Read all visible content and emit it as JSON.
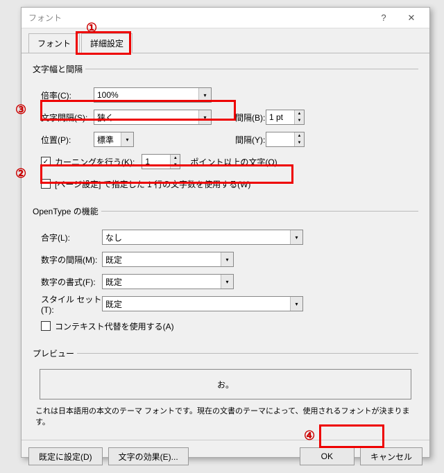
{
  "dialog": {
    "title": "フォント",
    "help": "?",
    "close": "✕"
  },
  "tabs": {
    "font": "フォント",
    "advanced": "詳細設定"
  },
  "spacing_group": {
    "legend": "文字幅と間隔",
    "scale_label": "倍率(C):",
    "scale_value": "100%",
    "spacing_label": "文字間隔(S):",
    "spacing_value": "狭く",
    "pitch_label": "間隔(B):",
    "pitch_value": "1 pt",
    "position_label": "位置(P):",
    "position_value": "標準",
    "pitch2_label": "間隔(Y):",
    "pitch2_value": "",
    "kerning_label": "カーニングを行う(K):",
    "kerning_value": "1",
    "kerning_suffix": "ポイント以上の文字(O)",
    "pagegrid_label": "[ページ設定] で指定した 1 行の文字数を使用する(W)"
  },
  "opentype_group": {
    "legend": "OpenType の機能",
    "ligatures_label": "合字(L):",
    "ligatures_value": "なし",
    "numspacing_label": "数字の間隔(M):",
    "numspacing_value": "既定",
    "numform_label": "数字の書式(F):",
    "numform_value": "既定",
    "styleset_label": "スタイル セット(T):",
    "styleset_value": "既定",
    "contextual_label": "コンテキスト代替を使用する(A)"
  },
  "preview_group": {
    "legend": "プレビュー",
    "sample": "お。",
    "note": "これは日本語用の本文のテーマ フォントです。現在の文書のテーマによって、使用されるフォントが決まります。"
  },
  "buttons": {
    "defaults": "既定に設定(D)",
    "effects": "文字の効果(E)...",
    "ok": "OK",
    "cancel": "キャンセル"
  },
  "callouts": {
    "c1": "①",
    "c2": "②",
    "c3": "③",
    "c4": "④"
  }
}
